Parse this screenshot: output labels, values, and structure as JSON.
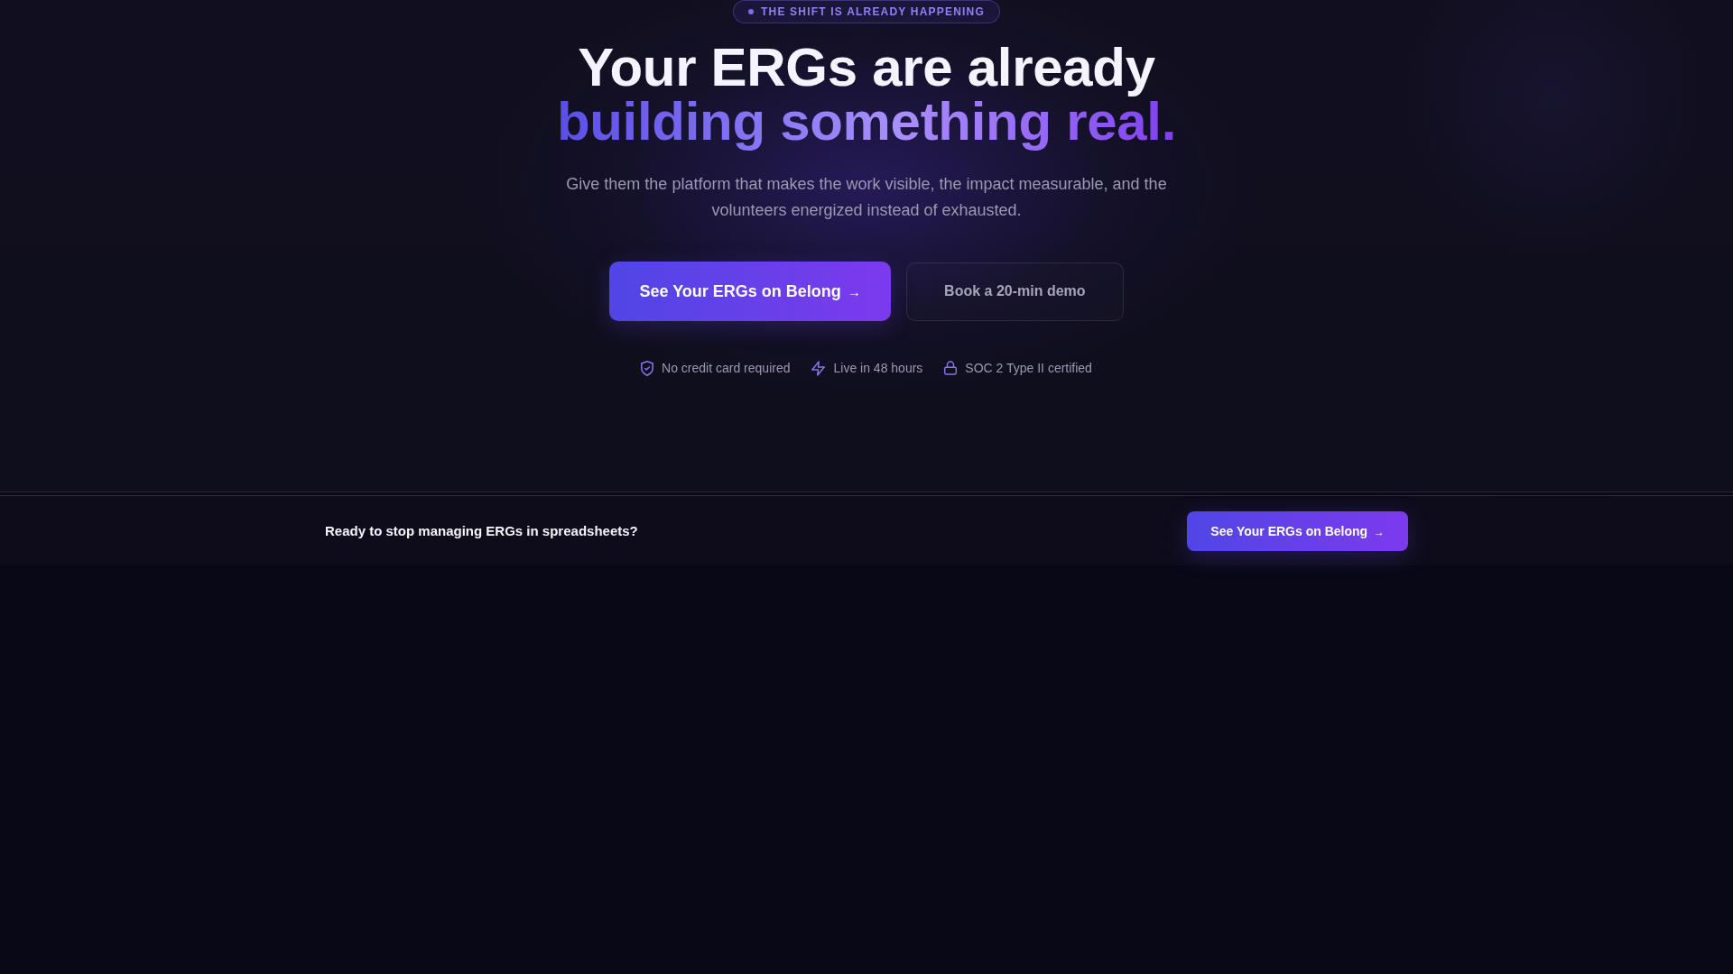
{
  "badge": {
    "text": "THE SHIFT IS ALREADY HAPPENING"
  },
  "hero": {
    "headline": "Your ERGs are already",
    "headline_highlight": "building something real.",
    "subtitle": "Give them the platform that makes the work visible, the impact measurable, and the volunteers energized instead of exhausted.",
    "buttons": [
      {
        "kind": "primary",
        "label": "See Your ERGs on Belong",
        "arrow": "→"
      },
      {
        "kind": "secondary",
        "label": "Book a 20-min demo"
      }
    ],
    "trust_items": [
      {
        "kind": "shield",
        "text": "No credit card required"
      },
      {
        "kind": "bolt",
        "text": "Live in 48 hours"
      },
      {
        "kind": "lock",
        "text": "SOC 2 Type II certified"
      }
    ]
  },
  "cta_bar": {
    "text": "Ready to stop managing ERGs in spreadsheets?",
    "button": {
      "kind": "primary",
      "label": "See Your ERGs on Belong",
      "arrow": "→"
    }
  }
}
